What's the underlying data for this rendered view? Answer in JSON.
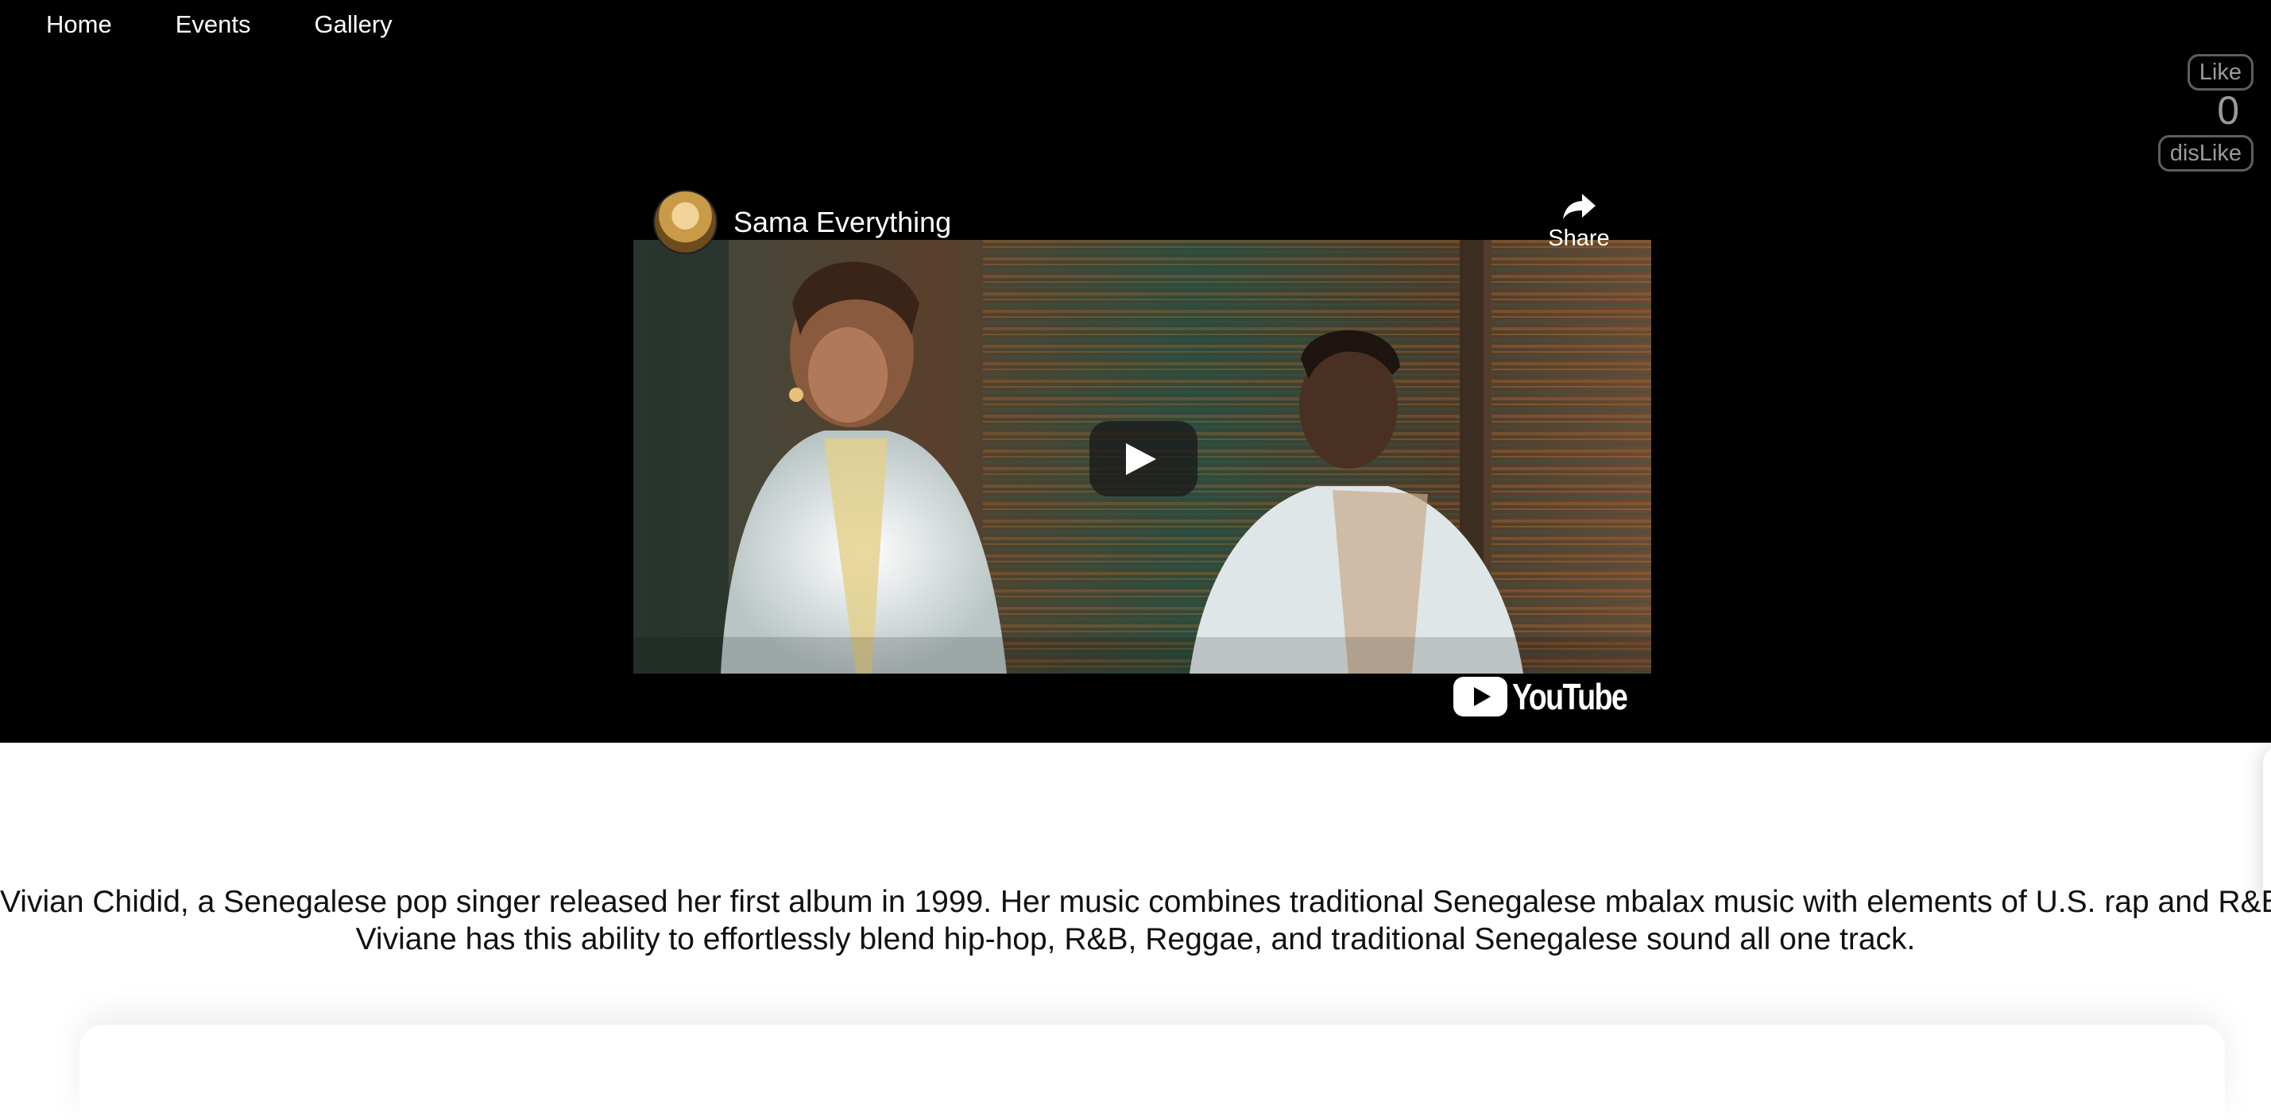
{
  "nav": {
    "items": [
      {
        "label": "Home"
      },
      {
        "label": "Events"
      },
      {
        "label": "Gallery"
      }
    ]
  },
  "votes": {
    "like_label": "Like",
    "count": "0",
    "dislike_label": "disLike"
  },
  "video": {
    "channel_name": "Sama Everything",
    "share_label": "Share",
    "logo_text": "YouTube"
  },
  "description": {
    "line1": "Vivian Chidid, a Senegalese pop singer released her first album in 1999. Her music combines traditional Senegalese mbalax music with elements of U.S. rap and R&B.",
    "line2": "Viviane has this ability to effortlessly blend hip-hop, R&B, Reggae, and traditional Senegalese sound all one track."
  },
  "colors": {
    "page_bg": "#ffffff",
    "hero_bg": "#000000",
    "text_dark": "#111111",
    "vote_gray": "#9a9a9a"
  }
}
